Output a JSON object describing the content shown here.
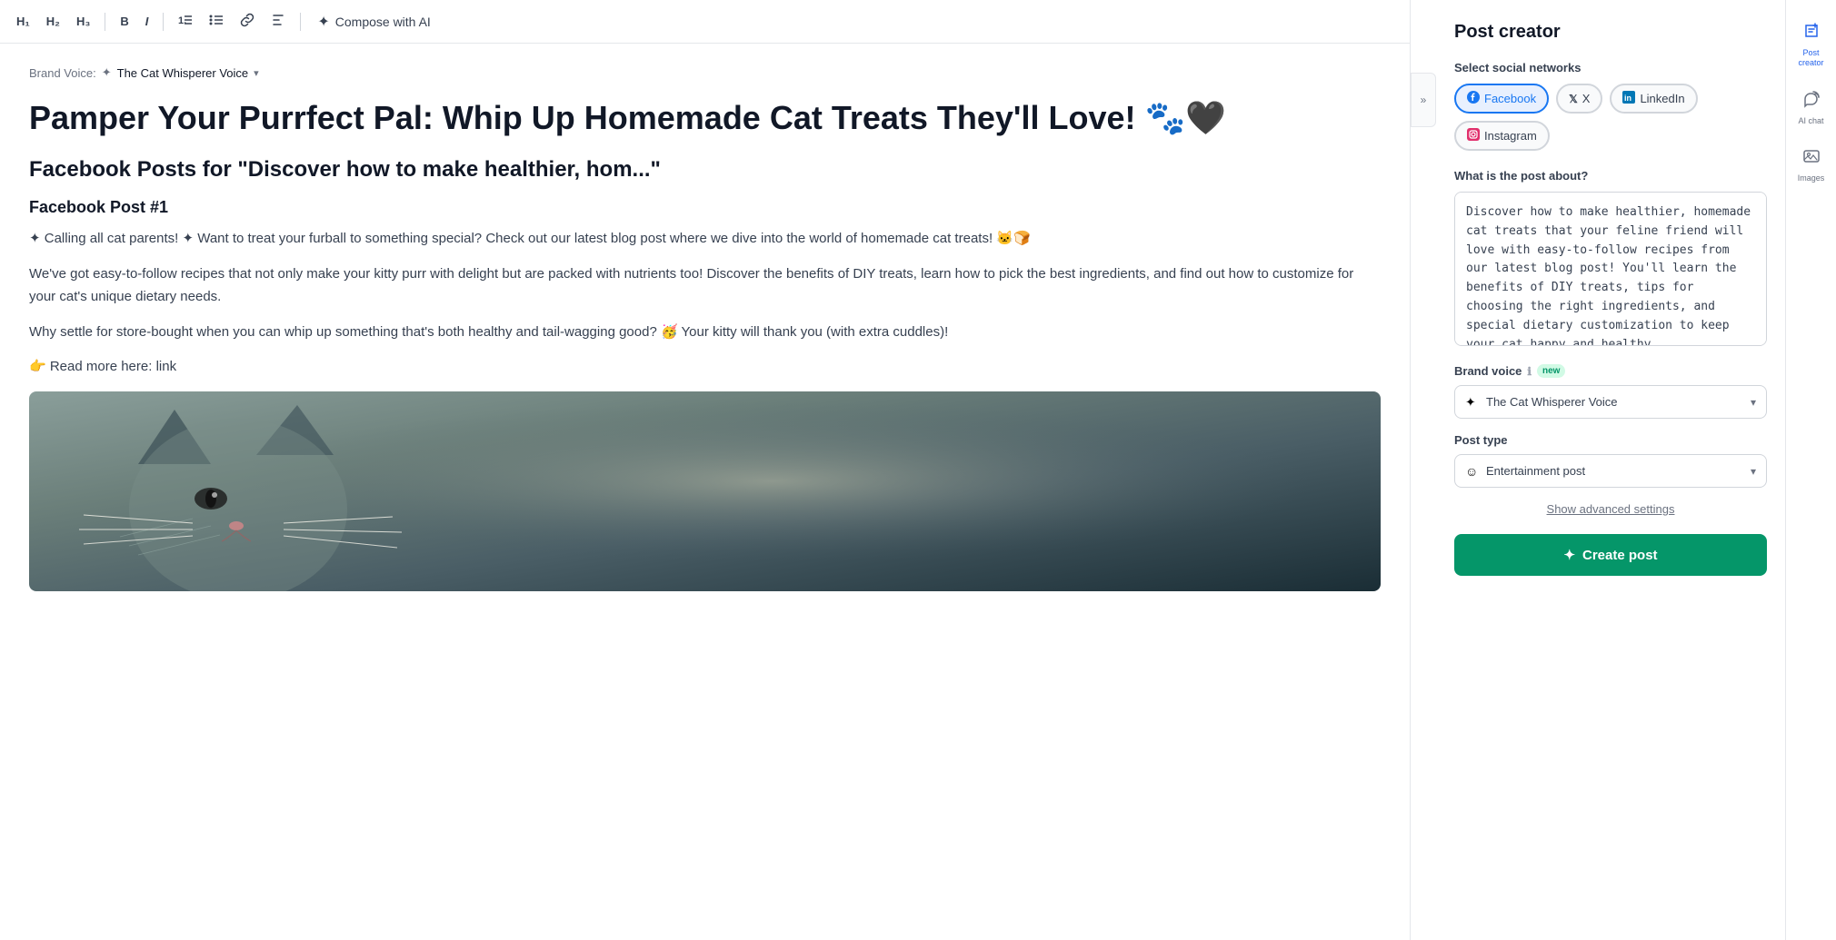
{
  "toolbar": {
    "h1_label": "H₁",
    "h2_label": "H₂",
    "h3_label": "H₃",
    "bold_label": "B",
    "italic_label": "I",
    "ordered_list_label": "≡",
    "unordered_list_label": "≡",
    "link_label": "🔗",
    "compose_ai_label": "Compose with AI"
  },
  "editor": {
    "brand_voice_label": "Brand Voice:",
    "brand_voice_icon": "✦",
    "brand_voice_name": "The Cat Whisperer Voice",
    "post_title": "Pamper Your Purrfect Pal: Whip Up Homemade Cat Treats They'll Love! 🐾🖤",
    "post_subtitle": "Facebook Posts for \"Discover how to make healthier, hom...\"",
    "post_number": "Facebook Post #1",
    "post_body_1": "✦ Calling all cat parents! ✦ Want to treat your furball to something special? Check out our latest blog post where we dive into the world of homemade cat treats! 🐱🍞",
    "post_body_2": "We've got easy-to-follow recipes that not only make your kitty purr with delight but are packed with nutrients too! Discover the benefits of DIY treats, learn how to pick the best ingredients, and find out how to customize for your cat's unique dietary needs.",
    "post_body_3": "Why settle for store-bought when you can whip up something that's both healthy and tail-wagging good? 🥳 Your kitty will thank you (with extra cuddles)!",
    "post_body_4": "👉 Read more here: link"
  },
  "right_panel": {
    "title": "Post creator",
    "select_networks_label": "Select social networks",
    "networks": [
      {
        "id": "facebook",
        "label": "Facebook",
        "icon": "f",
        "active": true
      },
      {
        "id": "twitter",
        "label": "X",
        "icon": "𝕏",
        "active": false
      },
      {
        "id": "linkedin",
        "label": "LinkedIn",
        "icon": "in",
        "active": false
      },
      {
        "id": "instagram",
        "label": "Instagram",
        "icon": "◻",
        "active": false
      }
    ],
    "about_label": "What is the post about?",
    "about_value": "Discover how to make healthier, homemade cat treats that your feline friend will love with easy-to-follow recipes from our latest blog post! You'll learn the benefits of DIY treats, tips for choosing the right ingredients, and special dietary customization to keep your cat happy and healthy.",
    "brand_voice_label": "Brand voice",
    "brand_voice_badge": "new",
    "brand_voice_value": "The Cat Whisperer Voice",
    "brand_voice_icon": "✦",
    "post_type_label": "Post type",
    "post_type_value": "Entertainment post",
    "post_type_icon": "☺",
    "advanced_settings_label": "Show advanced settings",
    "create_post_label": "Create post",
    "create_post_icon": "✦"
  },
  "side_icons": [
    {
      "id": "post-creator",
      "symbol": "📋",
      "label": "Post creator",
      "active": true
    },
    {
      "id": "ai-chat",
      "symbol": "↺",
      "label": "AI chat",
      "active": false
    },
    {
      "id": "images",
      "symbol": "🖼",
      "label": "Images",
      "active": false
    }
  ],
  "collapse_icon": "»"
}
